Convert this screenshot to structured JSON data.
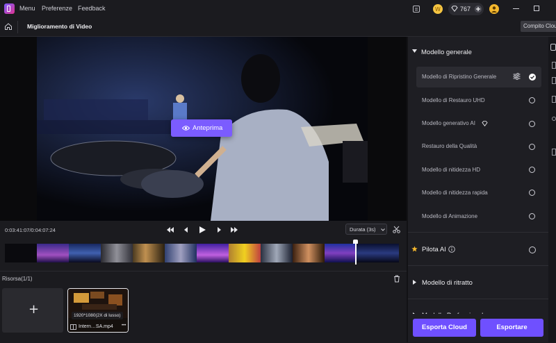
{
  "topbar": {
    "menu_label": "Menu",
    "preferences_label": "Preferenze",
    "feedback_label": "Feedback",
    "credits": "767",
    "icons": [
      "app-logo-icon",
      "task-list-icon",
      "coin-icon",
      "diamond-icon",
      "plus-circle-icon",
      "user-avatar-icon",
      "minimize-icon",
      "maximize-icon"
    ]
  },
  "navbar": {
    "title": "Miglioramento di Video",
    "tooltip": "Compito Cloud"
  },
  "player": {
    "preview_label": "Anteprima",
    "timecode": "0:03:41:07/0:04:07:24",
    "duration_label": "Durata (3s)",
    "playhead_progress": 0.89
  },
  "resources": {
    "title": "Risorsa(1/1)",
    "add_label": "+",
    "clip_resolution": "1920*1080(2X di lusso)",
    "clip_name": "Intern…SA.mp4",
    "more_label": "•••"
  },
  "right_panel": {
    "general_section": {
      "title": "Modello generale",
      "models": [
        {
          "label": "Modello di Ripristino Generale",
          "selected": true
        },
        {
          "label": "Modello di Restauro UHD",
          "selected": false
        },
        {
          "label": "Modello generativo AI",
          "selected": false
        },
        {
          "label": "Restauro della Qualità",
          "selected": false
        },
        {
          "label": "Modello di nitidezza HD",
          "selected": false
        },
        {
          "label": "Modello di nitidezza rapida",
          "selected": false
        },
        {
          "label": "Modello di Animazione",
          "selected": false
        }
      ]
    },
    "pilot_label": "Pilota AI",
    "portrait_label": "Modello di ritratto",
    "pro_label": "Modello Professionale",
    "export_cloud_label": "Esporta Cloud",
    "export_label": "Esportare"
  },
  "colors": {
    "accent": "#7b5cff",
    "background": "#1b1b1f",
    "panel": "#1e1e23",
    "star": "#f5b82e"
  }
}
